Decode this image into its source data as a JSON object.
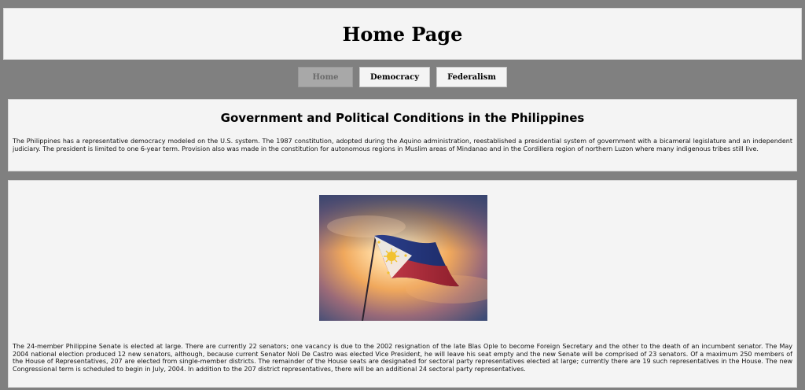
{
  "header": {
    "title": "Home Page"
  },
  "nav": {
    "items": [
      {
        "label": "Home"
      },
      {
        "label": "Democracy"
      },
      {
        "label": "Federalism"
      }
    ]
  },
  "main": {
    "heading": "Government and Political Conditions in the Philippines",
    "intro": "The Philippines has a representative democracy modeled on the U.S. system. The 1987 constitution, adopted during the Aquino administration, reestablished a presidential system of government with a bicameral legislature and an independent judiciary. The president is limited to one 6-year term. Provision also was made in the constitution for autonomous regions in Muslim areas of Mindanao and in the Cordillera region of northern Luzon where many indigenous tribes still live.",
    "senate": "The 24-member Philippine Senate is elected at large. There are currently 22 senators; one vacancy is due to the 2002 resignation of the late Blas Ople to become Foreign Secretary and the other to the death of an incumbent senator. The May 2004 national election produced 12 new senators, although, because current Senator Noli De Castro was elected Vice President, he will leave his seat empty and the new Senate will be comprised of 23 senators. Of a maximum 250 members of the House of Representatives, 207 are elected from single-member districts. The remainder of the House seats are designated for sectoral party representatives elected at large; currently there are 19 such representatives in the House. The new Congressional term is scheduled to begin in July, 2004. In addition to the 207 district representatives, there will be an additional 24 sectoral party representatives."
  }
}
